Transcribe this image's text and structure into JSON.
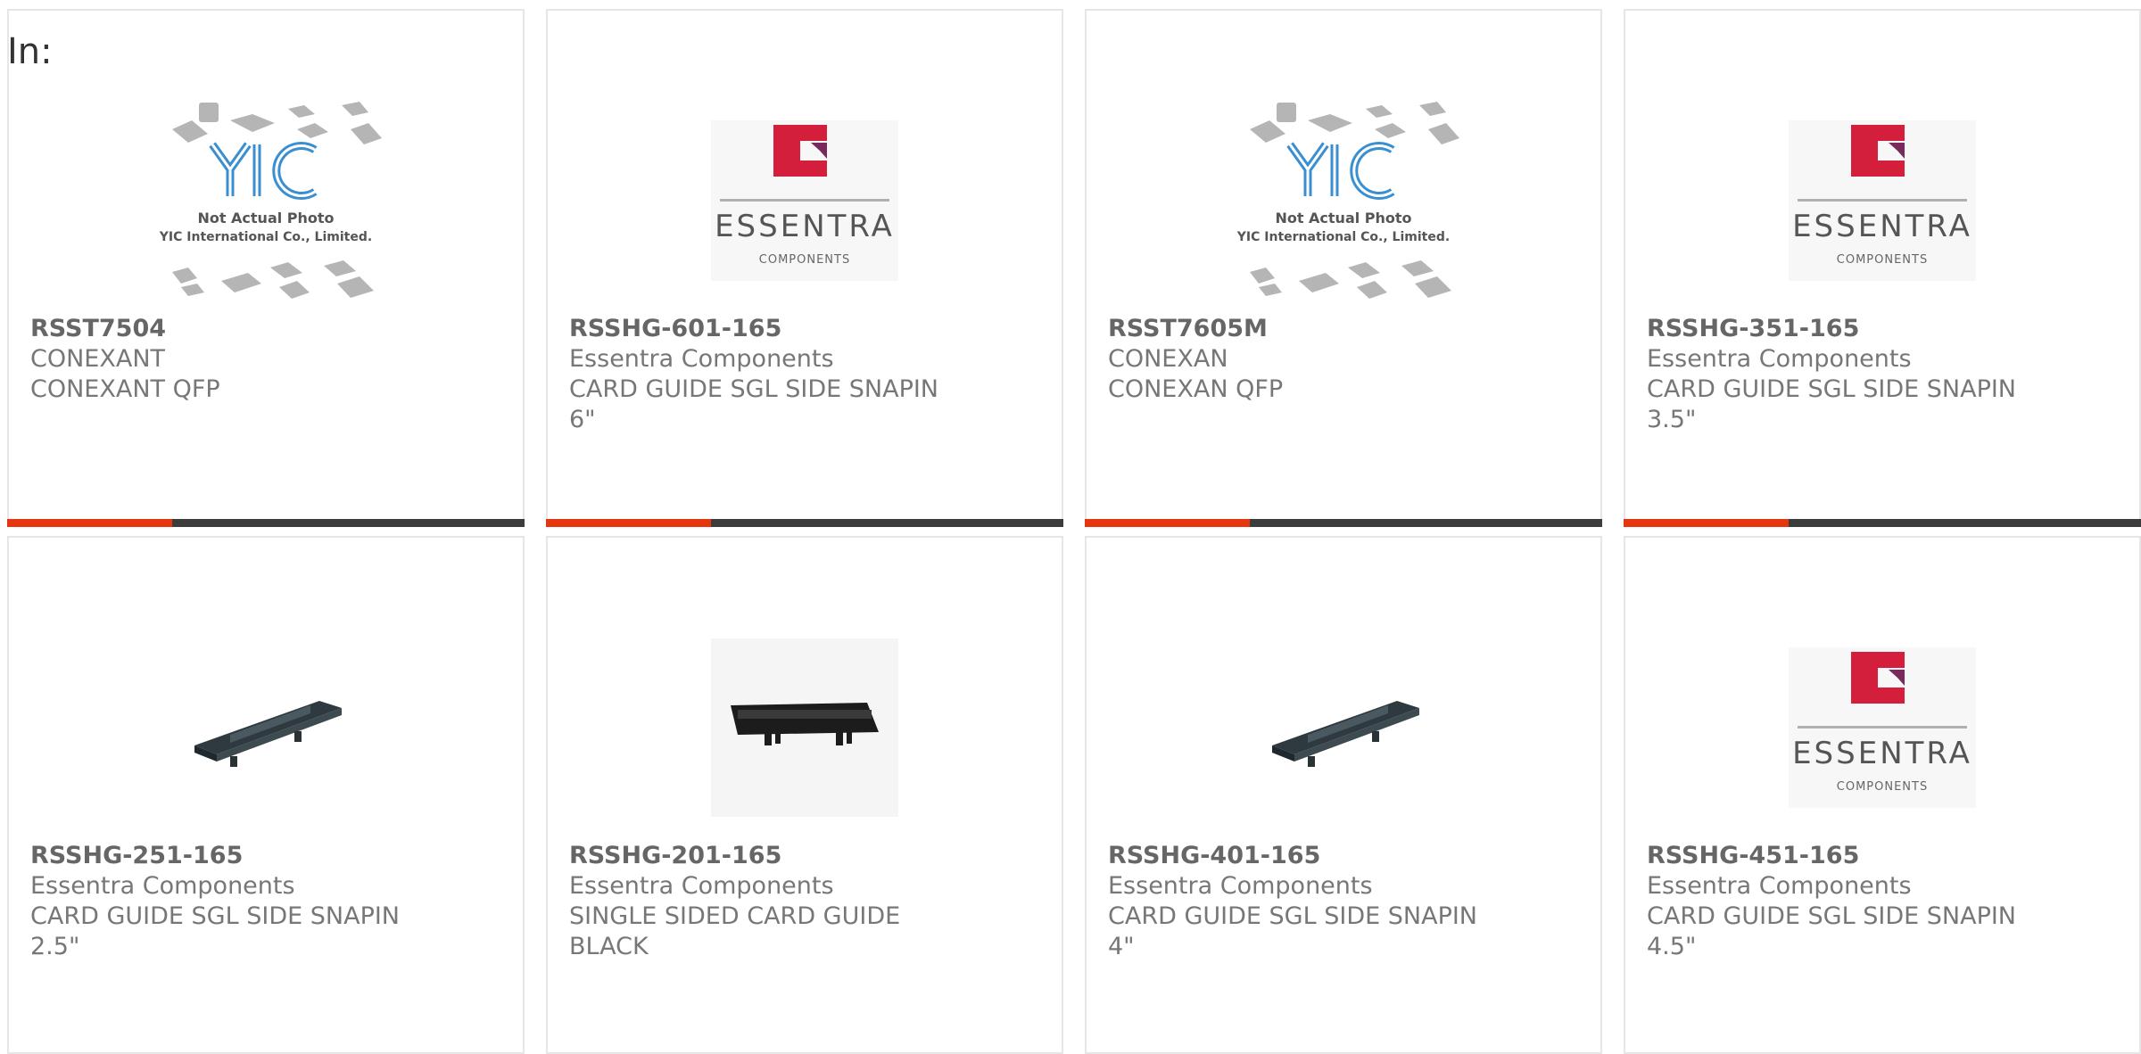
{
  "filter_label": "In:",
  "colors": {
    "accent": "#e5360f",
    "bar": "#3c3c3c"
  },
  "products": [
    {
      "part_number": "RSST7504",
      "manufacturer": "CONEXANT",
      "description": "CONEXANT QFP",
      "image": "yic-placeholder-icon",
      "placeholder": {
        "title": "Not Actual Photo",
        "company": "YIC International Co., Limited.",
        "logo": "YIC"
      }
    },
    {
      "part_number": "RSSHG-601-165",
      "manufacturer": "Essentra Components",
      "description": "CARD GUIDE SGL SIDE SNAPIN 6\"",
      "image": "essentra-logo",
      "brand": {
        "name": "ESSENTRA",
        "sub": "COMPONENTS"
      }
    },
    {
      "part_number": "RSST7605M",
      "manufacturer": "CONEXAN",
      "description": "CONEXAN QFP",
      "image": "yic-placeholder-icon",
      "placeholder": {
        "title": "Not Actual Photo",
        "company": "YIC International Co., Limited.",
        "logo": "YIC"
      }
    },
    {
      "part_number": "RSSHG-351-165",
      "manufacturer": "Essentra Components",
      "description": "CARD GUIDE SGL SIDE SNAPIN 3.5\"",
      "image": "essentra-logo",
      "brand": {
        "name": "ESSENTRA",
        "sub": "COMPONENTS"
      }
    },
    {
      "part_number": "RSSHG-251-165",
      "manufacturer": "Essentra Components",
      "description": "CARD GUIDE SGL SIDE SNAPIN 2.5\"",
      "image": "card-guide-angled"
    },
    {
      "part_number": "RSSHG-201-165",
      "manufacturer": "Essentra Components",
      "description": "SINGLE SIDED CARD GUIDE BLACK",
      "image": "card-guide-front"
    },
    {
      "part_number": "RSSHG-401-165",
      "manufacturer": "Essentra Components",
      "description": "CARD GUIDE SGL SIDE SNAPIN 4\"",
      "image": "card-guide-angled"
    },
    {
      "part_number": "RSSHG-451-165",
      "manufacturer": "Essentra Components",
      "description": "CARD GUIDE SGL SIDE SNAPIN 4.5\"",
      "image": "essentra-logo",
      "brand": {
        "name": "ESSENTRA",
        "sub": "COMPONENTS"
      }
    }
  ]
}
